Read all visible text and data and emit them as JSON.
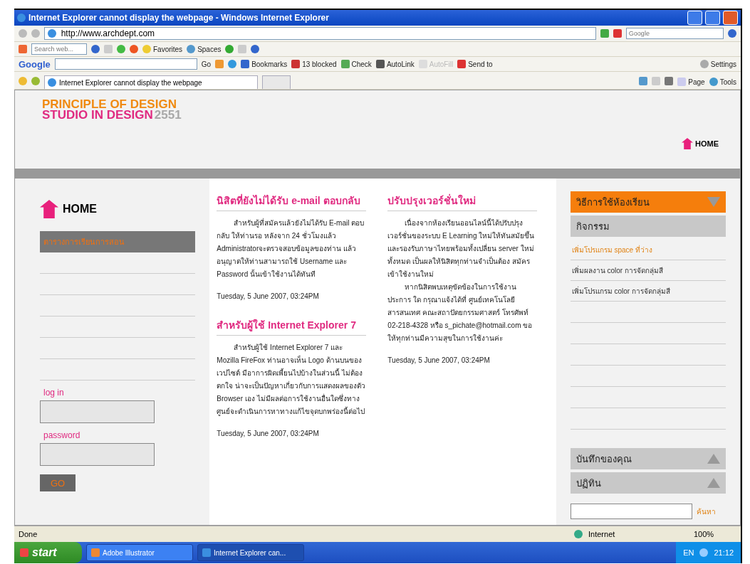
{
  "window": {
    "title": "Internet Explorer cannot display the webpage - Windows Internet Explorer"
  },
  "address_bar": {
    "url": "http://www.archdept.com",
    "search_placeholder": "Google"
  },
  "toolbar": {
    "search_placeholder": "Search web...",
    "items": [
      "Favorites",
      "Spaces"
    ]
  },
  "google_toolbar": {
    "logo": "Google",
    "go": "Go",
    "items": [
      {
        "label": "Bookmarks",
        "disabled": false
      },
      {
        "label": "13 blocked",
        "disabled": false
      },
      {
        "label": "Check",
        "disabled": false
      },
      {
        "label": "AutoLink",
        "disabled": false
      },
      {
        "label": "AutoFill",
        "disabled": true
      },
      {
        "label": "Send to",
        "disabled": false
      }
    ],
    "settings": "Settings"
  },
  "tabs": [
    {
      "label": "Internet Explorer cannot display the webpage",
      "selected": true
    }
  ],
  "command_bar": [
    "Page",
    "Tools"
  ],
  "page": {
    "logo": {
      "line1": "PRINCIPLE OF DESIGN",
      "line2": "STUDIO IN DESIGN",
      "year": "2551"
    },
    "home_link": "HOME",
    "sidebar": {
      "home": "HOME",
      "items": [
        {
          "label": "ตารางการเรียนการสอน",
          "selected": true
        }
      ],
      "login": {
        "user_label": "log in",
        "password_label": "password",
        "button": "GO"
      }
    },
    "columns": [
      [
        {
          "title": "นิสิตที่ยังไม่ได้รับ e-mail ตอบกลับ",
          "paragraphs": [
            "สำหรับผู้ที่สมัครแล้วยังไม่ได้รับ E-mail ตอบกลับ ให้ท่านรอ หลังจาก 24 ชั่วโมงแล้ว Administratorจะตรวจสอบข้อมูลของท่าน แล้วอนุญาตให้ท่านสามารถใช้ Username และ Password นั้นเข้าใช้งานได้ทันที"
          ],
          "date": "Tuesday, 5 June 2007, 03:24PM"
        },
        {
          "title": "สำหรับผู้ใช้ Internet Explorer 7",
          "paragraphs": [
            "สำหรับผู้ใช้ Internet Explorer 7 และ Mozilla FireFox ท่านอาจเห็น Logo ด้านบนของเวปไซต์ มีอาการผิดเพี้ยนไปบ้างในส่วนนี้ ไม่ต้องตกใจ น่าจะเป็นปัญหาเกี่ยวกับการแสดงผลของตัว Browser เอง ไม่มีผลต่อการใช้งานอื่นใดซึ่งทางศูนย์จะดำเนินการหาทางแก้ไขจุดบกพร่องนี้ต่อไป"
          ],
          "date": "Tuesday, 5 June 2007, 03:24PM"
        }
      ],
      [
        {
          "title": "ปรับปรุงเวอร์ชั่นใหม่",
          "paragraphs": [
            "เนื่องจากห้องเรียนออนไลน์นี้ได้ปรับปรุงเวอร์ชั่นของระบบ E Learning ใหม่ให้ทันสมัยขึ้น และรองรับภาษาไทยพร้อมทั้งเปลี่ยน server ใหม่ทั้งหมด เป็นผลให้นิสิตทุกท่านจำเป็นต้อง สมัครเข้าใช้งานใหม่",
            "หากนิสิตพบเหตุขัดข้องในการใช้งานประการ ใด กรุณาแจ้งได้ที่ ศูนย์เทคโนโลยีสารสนเทศ คณะสถาปัตยกรรมศาสตร์ โทรศัพท์ 02-218-4328 หรือ s_pichate@hotmail.com ขอให้ทุกท่านมีความสุขในการใช้งานค่ะ"
          ],
          "date": "Tuesday, 5 June 2007, 03:24PM"
        }
      ]
    ],
    "right_panel": {
      "header": "วิธีการใช้ห้องเรียน",
      "section": "กิจกรรม",
      "links": [
        {
          "label": "เพิ่มโปรแกรม space ที่ว่าง",
          "selected": true
        },
        {
          "label": "เพิ่มผลงาน color การจัดกลุ่มสี",
          "selected": false
        },
        {
          "label": "เพิ่มโปรแกรม color การจัดกลุ่มสี",
          "selected": false
        }
      ],
      "notes": "บันทึกของคุณ",
      "calendar": "ปฏิทิน",
      "search_button": "ค้นหา"
    }
  },
  "status_bar": {
    "text": "Done",
    "zone": "Internet",
    "zoom": "100%"
  },
  "taskbar": {
    "start": "start",
    "items": [
      {
        "label": "Adobe Illustrator",
        "selected": false
      },
      {
        "label": "Internet Explorer can...",
        "selected": true
      }
    ],
    "language": "EN",
    "clock": "21:12"
  }
}
